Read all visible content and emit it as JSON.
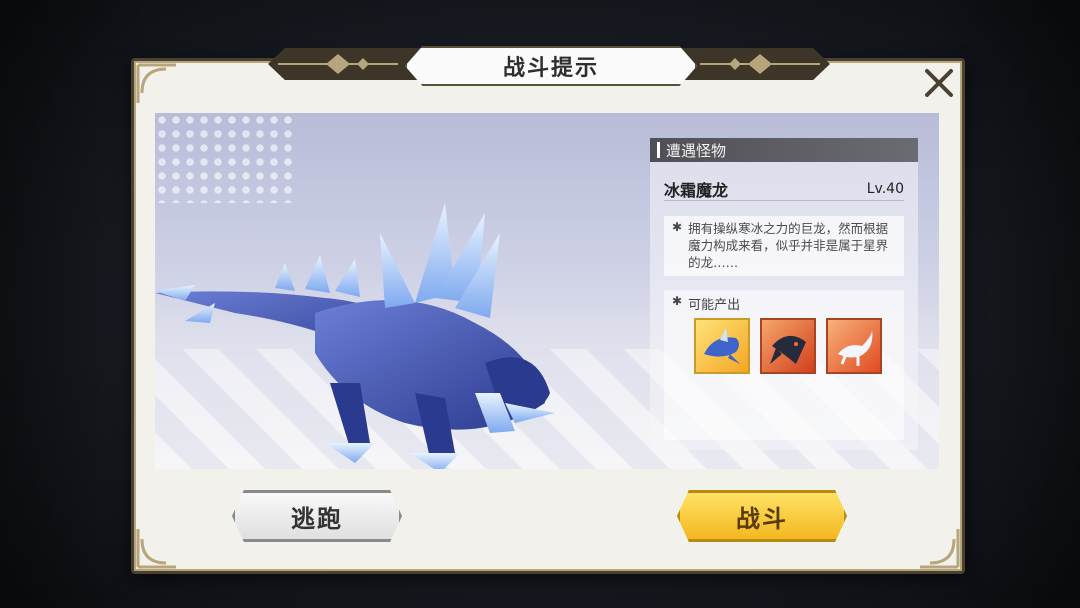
{
  "dialog": {
    "title": "战斗提示",
    "close_icon": "close-icon"
  },
  "info": {
    "section_title": "遭遇怪物",
    "monster_name": "冰霜魔龙",
    "monster_level": "Lv.40",
    "description": "拥有操纵寒冰之力的巨龙，然而根据魔力构成来看，似乎并非是属于星界的龙……",
    "drops_label": "可能产出",
    "drops": [
      {
        "icon": "ice-whale-icon"
      },
      {
        "icon": "dark-dragon-icon"
      },
      {
        "icon": "white-lizard-icon"
      }
    ]
  },
  "buttons": {
    "flee": "逃跑",
    "fight": "战斗"
  },
  "colors": {
    "frame": "#4a4131",
    "fight_button": "#f3b51b",
    "flee_button": "#e6e6e6",
    "header": "#5a5a60"
  }
}
